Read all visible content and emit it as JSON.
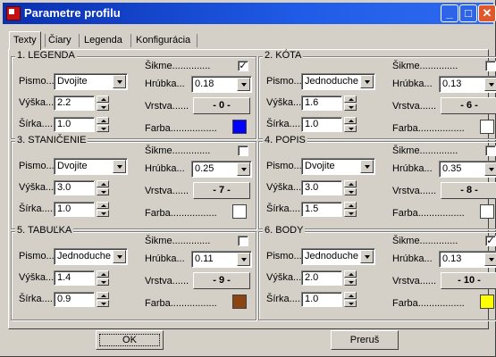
{
  "window": {
    "title": "Parametre profilu"
  },
  "tabs": [
    {
      "label": "Texty",
      "active": true
    },
    {
      "label": "Čiary"
    },
    {
      "label": "Legenda"
    },
    {
      "label": "Konfigurácia"
    }
  ],
  "labels": {
    "pismo": "Pismo....",
    "vyska": "Výška....",
    "sirka": "Šírka.....",
    "sikme": "Šikme..............",
    "hrubka": "Hrúbka...",
    "vrstva": "Vrstva......",
    "farba": "Farba................."
  },
  "groups": [
    {
      "title": "1. LEGENDA",
      "font": "Dvojite",
      "height": "2.2",
      "width": "1.0",
      "slanted": true,
      "thickness": "0.18",
      "layer": "- 0 -",
      "color": "#0000ff"
    },
    {
      "title": "2. KÓTA",
      "font": "Jednoduche",
      "height": "1.6",
      "width": "1.0",
      "slanted": false,
      "thickness": "0.13",
      "layer": "- 6 -",
      "color": "#ffffff"
    },
    {
      "title": "3. STANIČENIE",
      "font": "Dvojite",
      "height": "3.0",
      "width": "1.0",
      "slanted": false,
      "thickness": "0.25",
      "layer": "- 7 -",
      "color": "#ffffff"
    },
    {
      "title": "4. POPIS",
      "font": "Dvojite",
      "height": "3.0",
      "width": "1.5",
      "slanted": false,
      "thickness": "0.35",
      "layer": "- 8 -",
      "color": "#ffffff"
    },
    {
      "title": "5. TABUĽKA",
      "font": "Jednoduche",
      "height": "1.4",
      "width": "0.9",
      "slanted": false,
      "thickness": "0.11",
      "layer": "- 9 -",
      "color": "#8b4513"
    },
    {
      "title": "6. BODY",
      "font": "Jednoduche",
      "height": "2.0",
      "width": "1.0",
      "slanted": true,
      "thickness": "0.13",
      "layer": "- 10 -",
      "color": "#ffff00"
    }
  ],
  "buttons": {
    "ok": "OK",
    "cancel": "Preruš"
  },
  "checkmark": "✓",
  "window_buttons": {
    "minimize": "_",
    "maximize": "□",
    "close": "✕"
  }
}
